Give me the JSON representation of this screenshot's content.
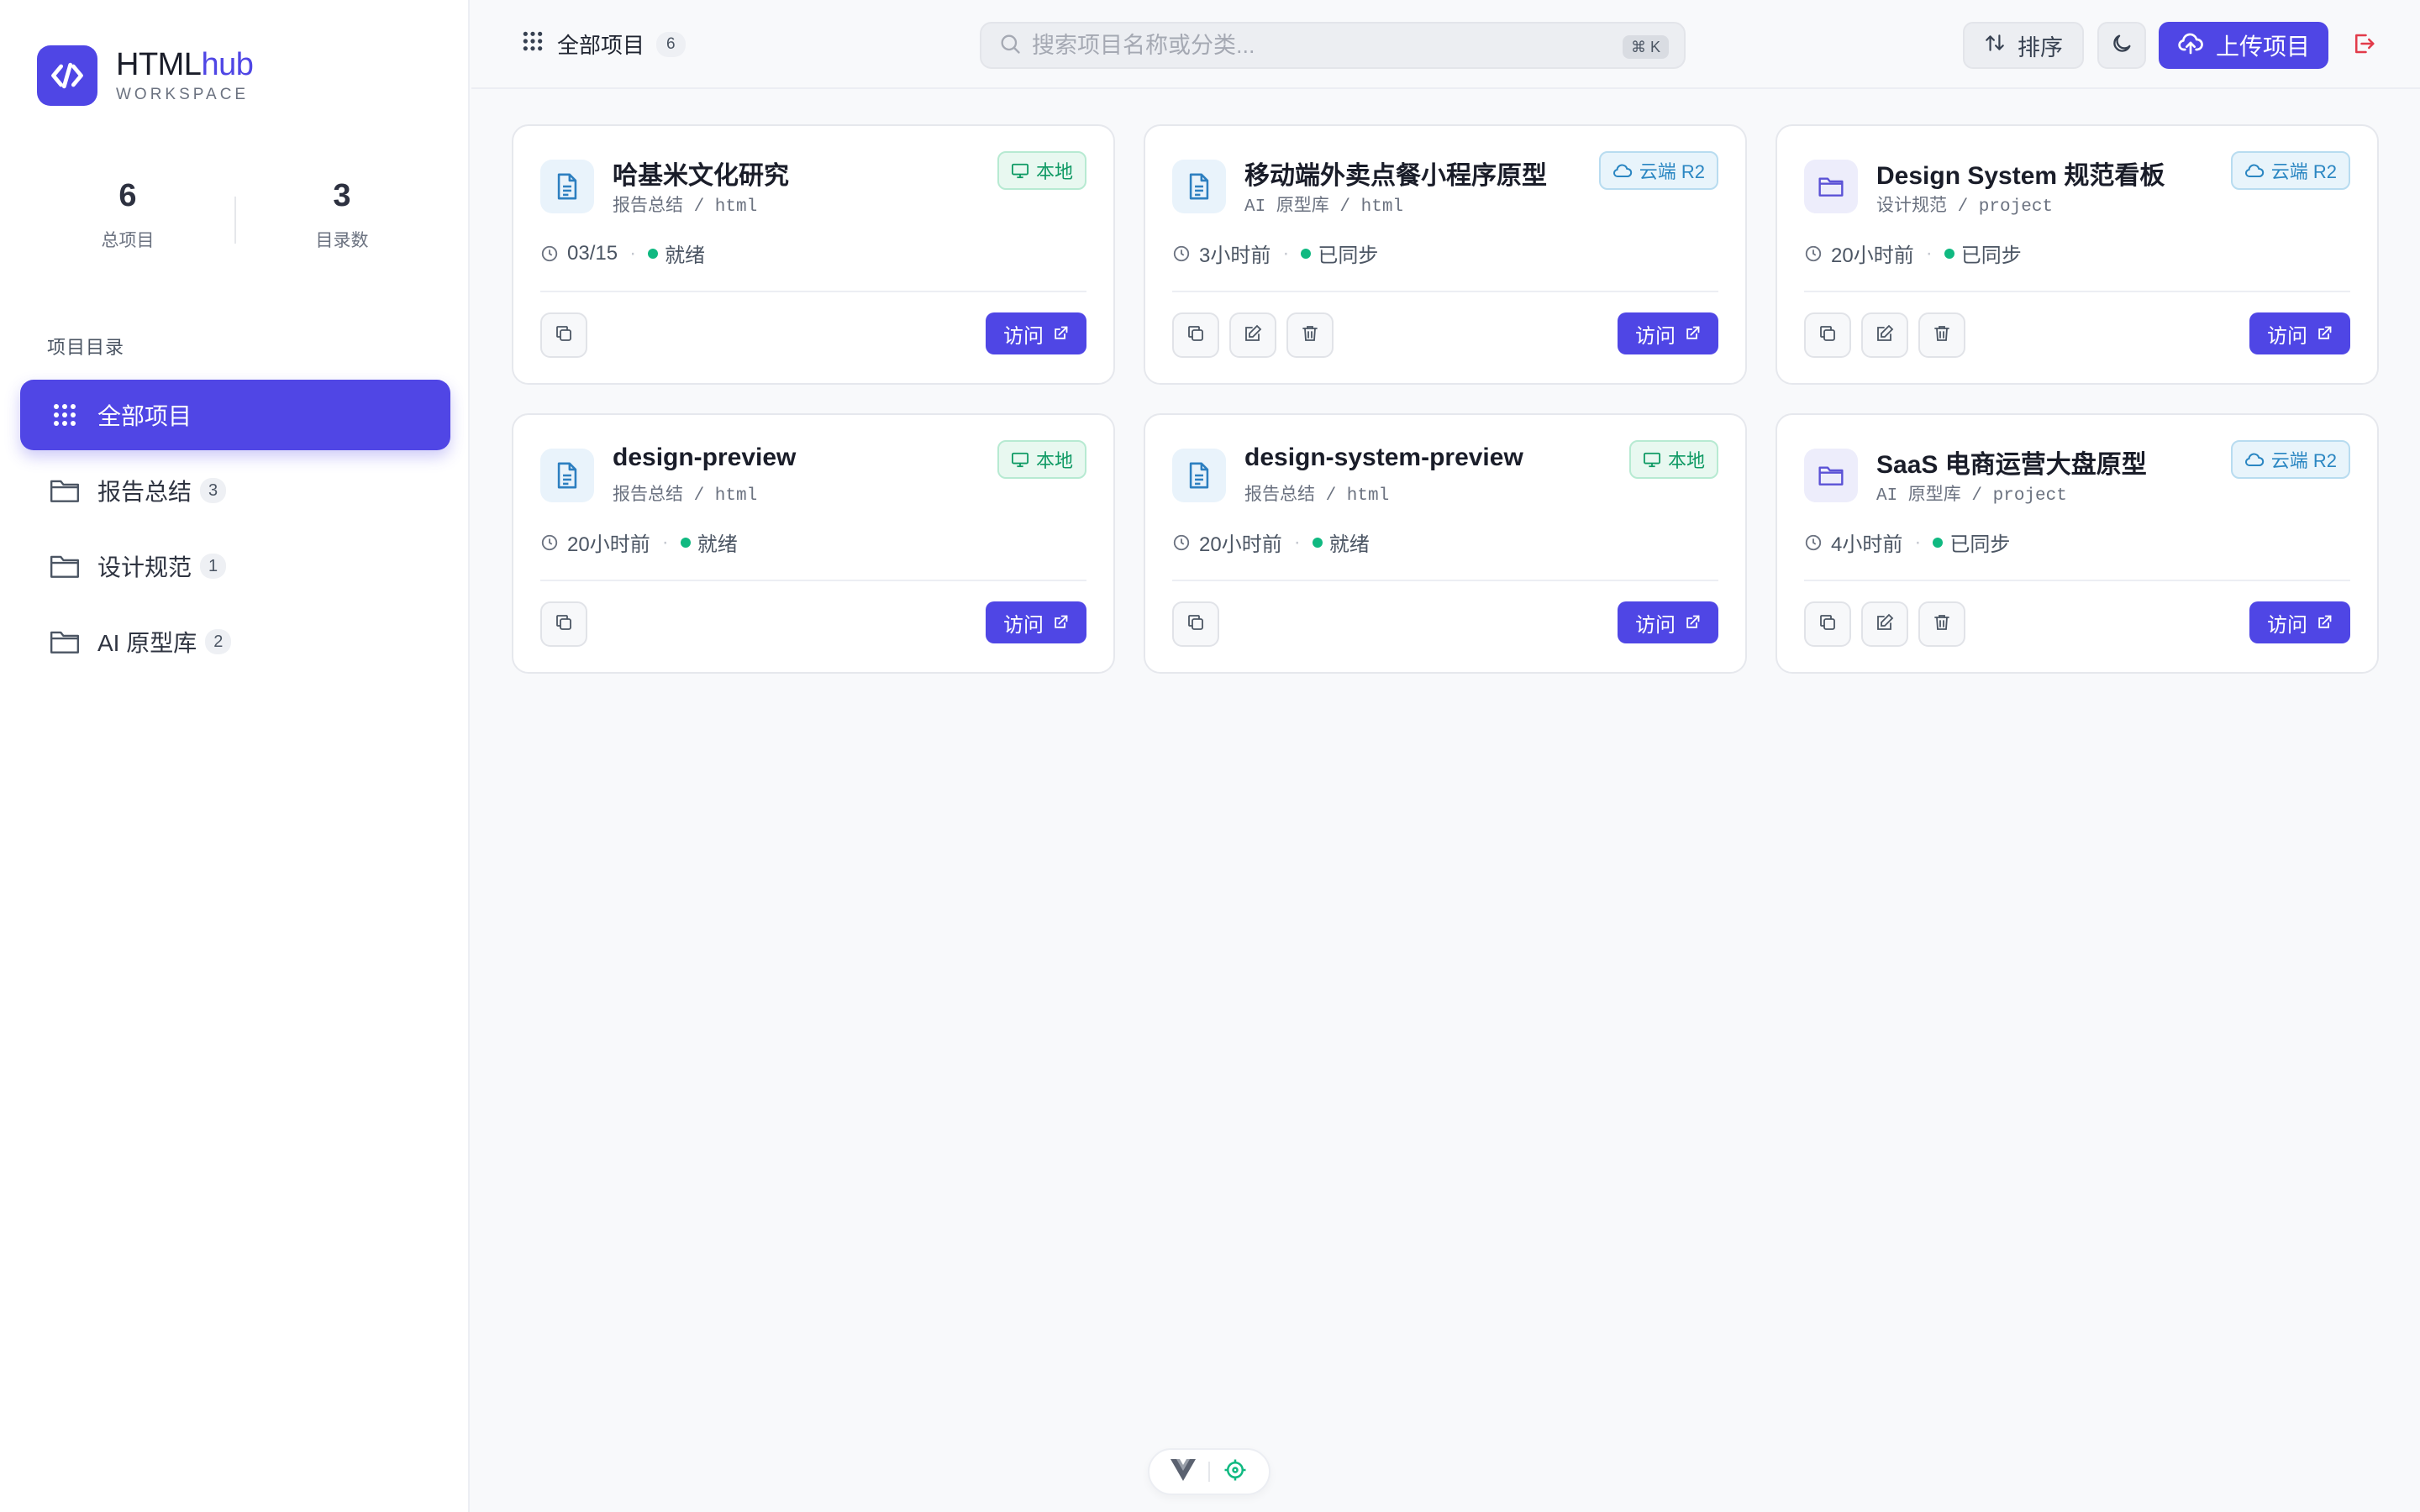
{
  "app": {
    "brand_main": "HTML",
    "brand_accent": "hub",
    "brand_sub": "WORKSPACE",
    "accent_color": "#4f46e5"
  },
  "stats": [
    {
      "value": "6",
      "label": "总项目"
    },
    {
      "value": "3",
      "label": "目录数"
    }
  ],
  "sidebar": {
    "section_label": "项目目录",
    "items": [
      {
        "label": "全部项目",
        "count": "",
        "icon": "grid-icon",
        "active": true
      },
      {
        "label": "报告总结",
        "count": "3",
        "icon": "folder-icon",
        "active": false
      },
      {
        "label": "设计规范",
        "count": "1",
        "icon": "folder-icon",
        "active": false
      },
      {
        "label": "AI 原型库",
        "count": "2",
        "icon": "folder-icon",
        "active": false
      }
    ]
  },
  "topbar": {
    "crumb_label": "全部项目",
    "crumb_count": "6",
    "search_placeholder": "搜索项目名称或分类...",
    "search_shortcut": "⌘ K",
    "sort_label": "排序",
    "upload_label": "上传项目"
  },
  "cards": [
    {
      "title": "哈基米文化研究",
      "path": "报告总结 / html",
      "tag": "本地",
      "tag_type": "local",
      "icon": "file",
      "time": "03/15",
      "status": "就绪",
      "editable": false
    },
    {
      "title": "移动端外卖点餐小程序原型",
      "path": "AI 原型库 / html",
      "tag": "云端 R2",
      "tag_type": "cloud",
      "icon": "file",
      "time": "3小时前",
      "status": "已同步",
      "editable": true
    },
    {
      "title": "Design System 规范看板",
      "path": "设计规范 / project",
      "tag": "云端 R2",
      "tag_type": "cloud",
      "icon": "folder",
      "time": "20小时前",
      "status": "已同步",
      "editable": true
    },
    {
      "title": "design-preview",
      "path": "报告总结 / html",
      "tag": "本地",
      "tag_type": "local",
      "icon": "file",
      "time": "20小时前",
      "status": "就绪",
      "editable": false
    },
    {
      "title": "design-system-preview",
      "path": "报告总结 / html",
      "tag": "本地",
      "tag_type": "local",
      "icon": "file",
      "time": "20小时前",
      "status": "就绪",
      "editable": false
    },
    {
      "title": "SaaS 电商运营大盘原型",
      "path": "AI 原型库 / project",
      "tag": "云端 R2",
      "tag_type": "cloud",
      "icon": "folder",
      "time": "4小时前",
      "status": "已同步",
      "editable": true
    }
  ],
  "card_common": {
    "visit_label": "访问"
  }
}
